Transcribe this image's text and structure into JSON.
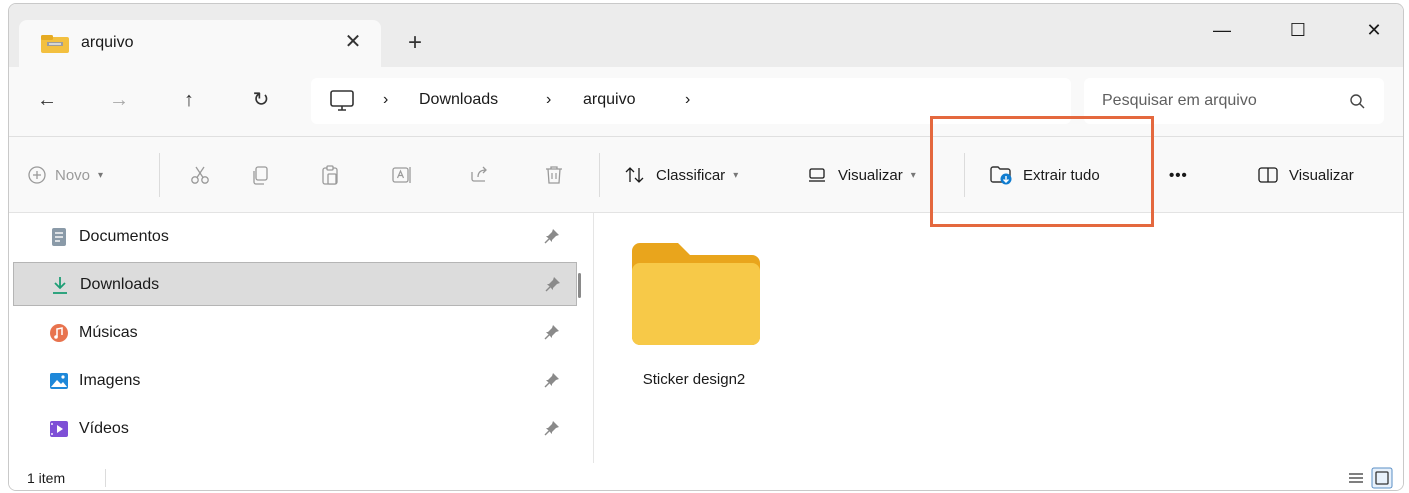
{
  "tab": {
    "title": "arquivo",
    "close": "✕",
    "new_tab": "+"
  },
  "window_controls": {
    "minimize": "—",
    "maximize": "☐",
    "close": "✕"
  },
  "nav": {
    "back": "←",
    "forward": "→",
    "up": "↑",
    "refresh": "↻"
  },
  "address": {
    "sep1": "›",
    "crumb1": "Downloads",
    "sep2": "›",
    "crumb2": "arquivo",
    "sep3": "›"
  },
  "search": {
    "placeholder": "Pesquisar em arquivo"
  },
  "toolbar": {
    "new_label": "Novo",
    "sort_label": "Classificar",
    "view_label": "Visualizar",
    "extract_label": "Extrair tudo",
    "more_label": "•••",
    "details_label": "Visualizar"
  },
  "sidebar": {
    "items": [
      {
        "label": "Documentos",
        "icon": "document-icon"
      },
      {
        "label": "Downloads",
        "icon": "download-icon",
        "selected": true
      },
      {
        "label": "Músicas",
        "icon": "music-icon"
      },
      {
        "label": "Imagens",
        "icon": "image-icon"
      },
      {
        "label": "Vídeos",
        "icon": "video-icon"
      }
    ]
  },
  "content": {
    "items": [
      {
        "name": "Sticker design2",
        "type": "folder"
      }
    ]
  },
  "status": {
    "count": "1 item"
  },
  "colors": {
    "highlight": "#e4683e",
    "folder": "#f7c948",
    "accent": "#0f7cd0"
  }
}
